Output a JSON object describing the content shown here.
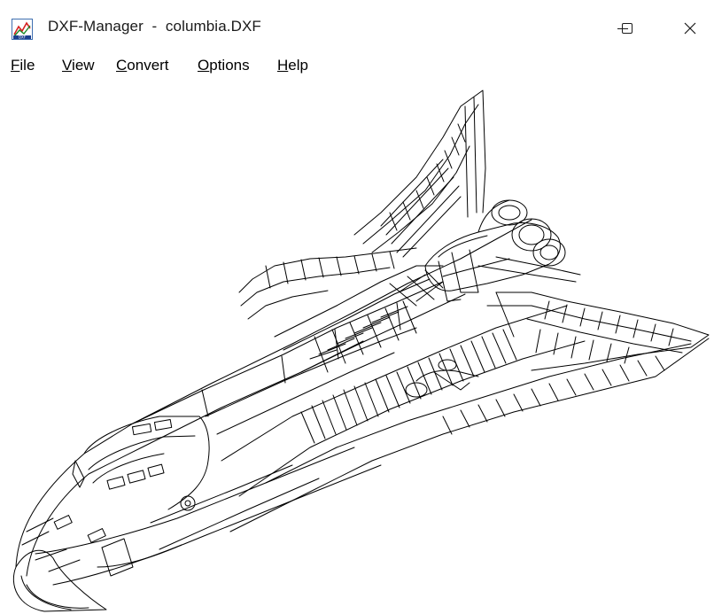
{
  "window": {
    "title": "DXF-Manager  -  columbia.DXF",
    "icon": "dxf-manager-app-icon"
  },
  "controls": {
    "minimize": "minimize-icon",
    "maximize": "maximize-icon",
    "close": "close-icon"
  },
  "menu": [
    {
      "label": "File",
      "accel": "F",
      "rest": "ile"
    },
    {
      "label": "View",
      "accel": "V",
      "rest": "iew"
    },
    {
      "label": "Convert",
      "accel": "C",
      "rest": "onvert"
    },
    {
      "label": "Options",
      "accel": "O",
      "rest": "ptions"
    },
    {
      "label": "Help",
      "accel": "H",
      "rest": "elp"
    }
  ],
  "drawing": {
    "subject": "space shuttle wireframe",
    "line_color": "#000000",
    "background": "#ffffff"
  }
}
